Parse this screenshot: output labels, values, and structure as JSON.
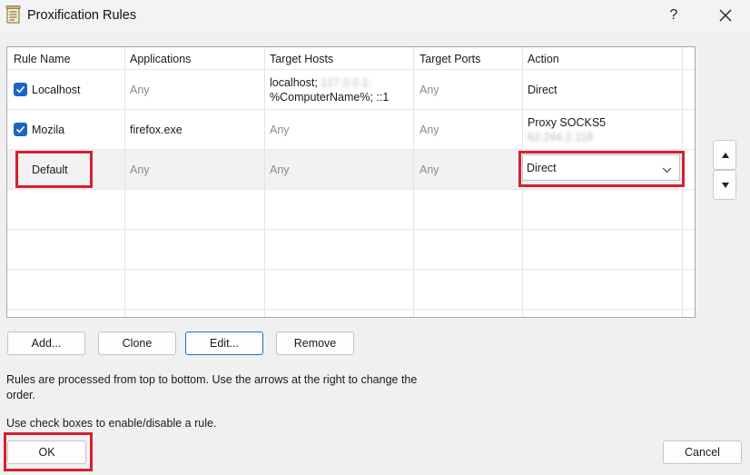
{
  "window": {
    "title": "Proxification Rules",
    "help_label": "?"
  },
  "table": {
    "columns": [
      "Rule Name",
      "Applications",
      "Target Hosts",
      "Target Ports",
      "Action"
    ],
    "rows": [
      {
        "enabled": true,
        "name": "Localhost",
        "applications": "Any",
        "target_hosts_line1": "localhost;",
        "target_hosts_blurred": "127.0.0.1;",
        "target_hosts_line2": "%ComputerName%; ::1",
        "target_ports": "Any",
        "action": "Direct"
      },
      {
        "enabled": true,
        "name": "Mozila",
        "applications": "firefox.exe",
        "target_hosts": "Any",
        "target_ports": "Any",
        "action_line1": "Proxy SOCKS5",
        "action_blurred": "62.244.2.118"
      },
      {
        "name": "Default",
        "applications": "Any",
        "target_hosts": "Any",
        "target_ports": "Any",
        "action": "Direct"
      }
    ]
  },
  "buttons": {
    "add": "Add...",
    "clone": "Clone",
    "edit": "Edit...",
    "remove": "Remove",
    "ok": "OK",
    "cancel": "Cancel"
  },
  "info": {
    "line1": "Rules are processed from top to bottom. Use the arrows at the right to change the",
    "line2": "order.",
    "line3": "Use check boxes to enable/disable a rule."
  },
  "colors": {
    "highlight": "#d42030",
    "checkbox": "#1d64c2",
    "focus_border": "#1a6fd0"
  }
}
